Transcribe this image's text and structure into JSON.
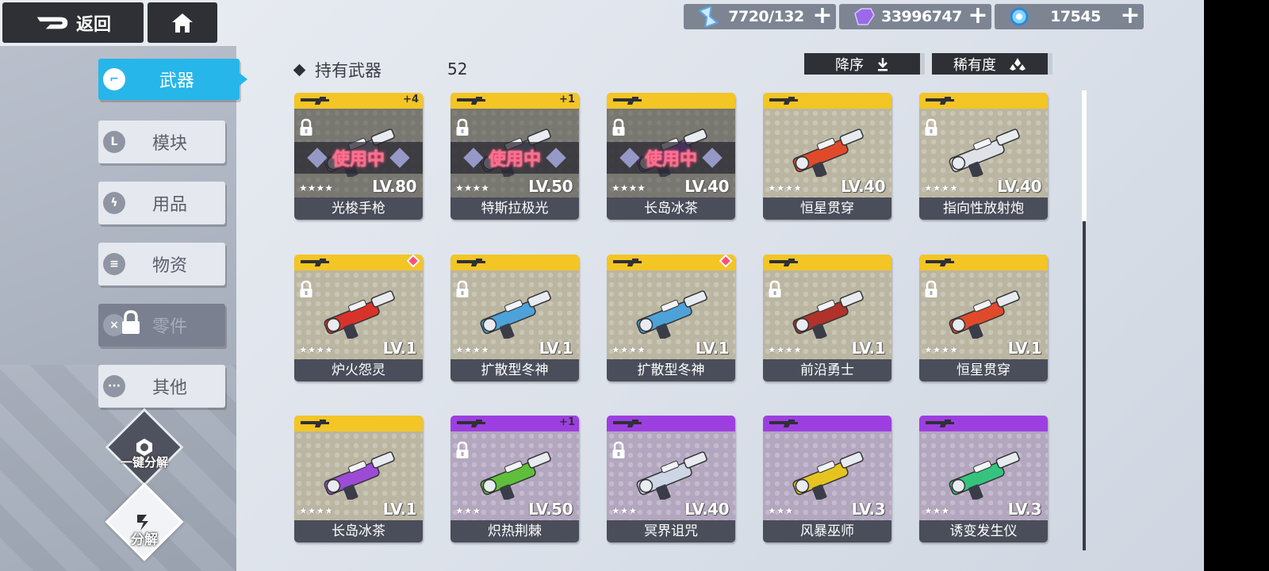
{
  "topbar": {
    "back_label": "返回",
    "resources": [
      {
        "icon": "hourglass-icon",
        "value": "7720/132"
      },
      {
        "icon": "purple-crystal-icon",
        "value": "33996747"
      },
      {
        "icon": "blue-orb-icon",
        "value": "17545"
      }
    ]
  },
  "sidebar": {
    "tabs": [
      {
        "label": "武器",
        "icon": "weapon-icon",
        "state": "active"
      },
      {
        "label": "模块",
        "icon": "module-icon",
        "state": "normal"
      },
      {
        "label": "用品",
        "icon": "lightning-icon",
        "state": "normal"
      },
      {
        "label": "物资",
        "icon": "supplies-icon",
        "state": "normal"
      },
      {
        "label": "零件",
        "icon": "parts-icon",
        "state": "locked"
      },
      {
        "label": "其他",
        "icon": "more-icon",
        "state": "normal"
      }
    ],
    "quick_dismantle_label": "一键分解",
    "dismantle_label": "分解"
  },
  "main": {
    "heading": "持有武器",
    "count": "52",
    "sort_label": "降序",
    "filter_label": "稀有度"
  },
  "colors": {
    "accent": "#27b6ea",
    "gold": "#f3c525",
    "purple": "#9d3fe0",
    "in_use": "#ff6f8e"
  },
  "cards": [
    {
      "name": "光梭手枪",
      "level": "LV.80",
      "stars": 4,
      "rarity": "gold",
      "plus": "+4",
      "equipped": true,
      "in_use_label": "使用中",
      "locked": true,
      "new": false,
      "weapon_color": "#9aa0ab"
    },
    {
      "name": "特斯拉极光",
      "level": "LV.50",
      "stars": 4,
      "rarity": "gold",
      "plus": "+1",
      "equipped": true,
      "in_use_label": "使用中",
      "locked": true,
      "new": false,
      "weapon_color": "#7a8190"
    },
    {
      "name": "长岛冰茶",
      "level": "LV.40",
      "stars": 4,
      "rarity": "gold",
      "plus": "",
      "equipped": true,
      "in_use_label": "使用中",
      "locked": true,
      "new": false,
      "weapon_color": "#9c4bd6"
    },
    {
      "name": "恒星贯穿",
      "level": "LV.40",
      "stars": 4,
      "rarity": "gold",
      "plus": "",
      "equipped": false,
      "in_use_label": "",
      "locked": false,
      "new": false,
      "weapon_color": "#e04a2a"
    },
    {
      "name": "指向性放射炮",
      "level": "LV.40",
      "stars": 4,
      "rarity": "gold",
      "plus": "",
      "equipped": false,
      "in_use_label": "",
      "locked": true,
      "new": false,
      "weapon_color": "#dfe2e8"
    },
    {
      "name": "炉火怨灵",
      "level": "LV.1",
      "stars": 4,
      "rarity": "gold",
      "plus": "",
      "equipped": false,
      "in_use_label": "",
      "locked": true,
      "new": true,
      "weapon_color": "#d8332a"
    },
    {
      "name": "扩散型冬神",
      "level": "LV.1",
      "stars": 4,
      "rarity": "gold",
      "plus": "",
      "equipped": false,
      "in_use_label": "",
      "locked": true,
      "new": false,
      "weapon_color": "#4da2d9"
    },
    {
      "name": "扩散型冬神",
      "level": "LV.1",
      "stars": 4,
      "rarity": "gold",
      "plus": "",
      "equipped": false,
      "in_use_label": "",
      "locked": false,
      "new": true,
      "weapon_color": "#4da2d9"
    },
    {
      "name": "前沿勇士",
      "level": "LV.1",
      "stars": 4,
      "rarity": "gold",
      "plus": "",
      "equipped": false,
      "in_use_label": "",
      "locked": true,
      "new": false,
      "weapon_color": "#b0322a"
    },
    {
      "name": "恒星贯穿",
      "level": "LV.1",
      "stars": 4,
      "rarity": "gold",
      "plus": "",
      "equipped": false,
      "in_use_label": "",
      "locked": true,
      "new": false,
      "weapon_color": "#e04a2a"
    },
    {
      "name": "长岛冰茶",
      "level": "LV.1",
      "stars": 4,
      "rarity": "gold",
      "plus": "",
      "equipped": false,
      "in_use_label": "",
      "locked": false,
      "new": false,
      "weapon_color": "#9c4bd6"
    },
    {
      "name": "炽热荆棘",
      "level": "LV.50",
      "stars": 3,
      "rarity": "purple",
      "plus": "+1",
      "equipped": false,
      "in_use_label": "",
      "locked": true,
      "new": false,
      "weapon_color": "#5fbf3a"
    },
    {
      "name": "冥界诅咒",
      "level": "LV.40",
      "stars": 3,
      "rarity": "purple",
      "plus": "",
      "equipped": false,
      "in_use_label": "",
      "locked": true,
      "new": false,
      "weapon_color": "#cdd6e4"
    },
    {
      "name": "风暴巫师",
      "level": "LV.3",
      "stars": 3,
      "rarity": "purple",
      "plus": "",
      "equipped": false,
      "in_use_label": "",
      "locked": false,
      "new": false,
      "weapon_color": "#e6c420"
    },
    {
      "name": "诱变发生仪",
      "level": "LV.3",
      "stars": 3,
      "rarity": "purple",
      "plus": "",
      "equipped": false,
      "in_use_label": "",
      "locked": false,
      "new": false,
      "weapon_color": "#35c47e"
    }
  ]
}
